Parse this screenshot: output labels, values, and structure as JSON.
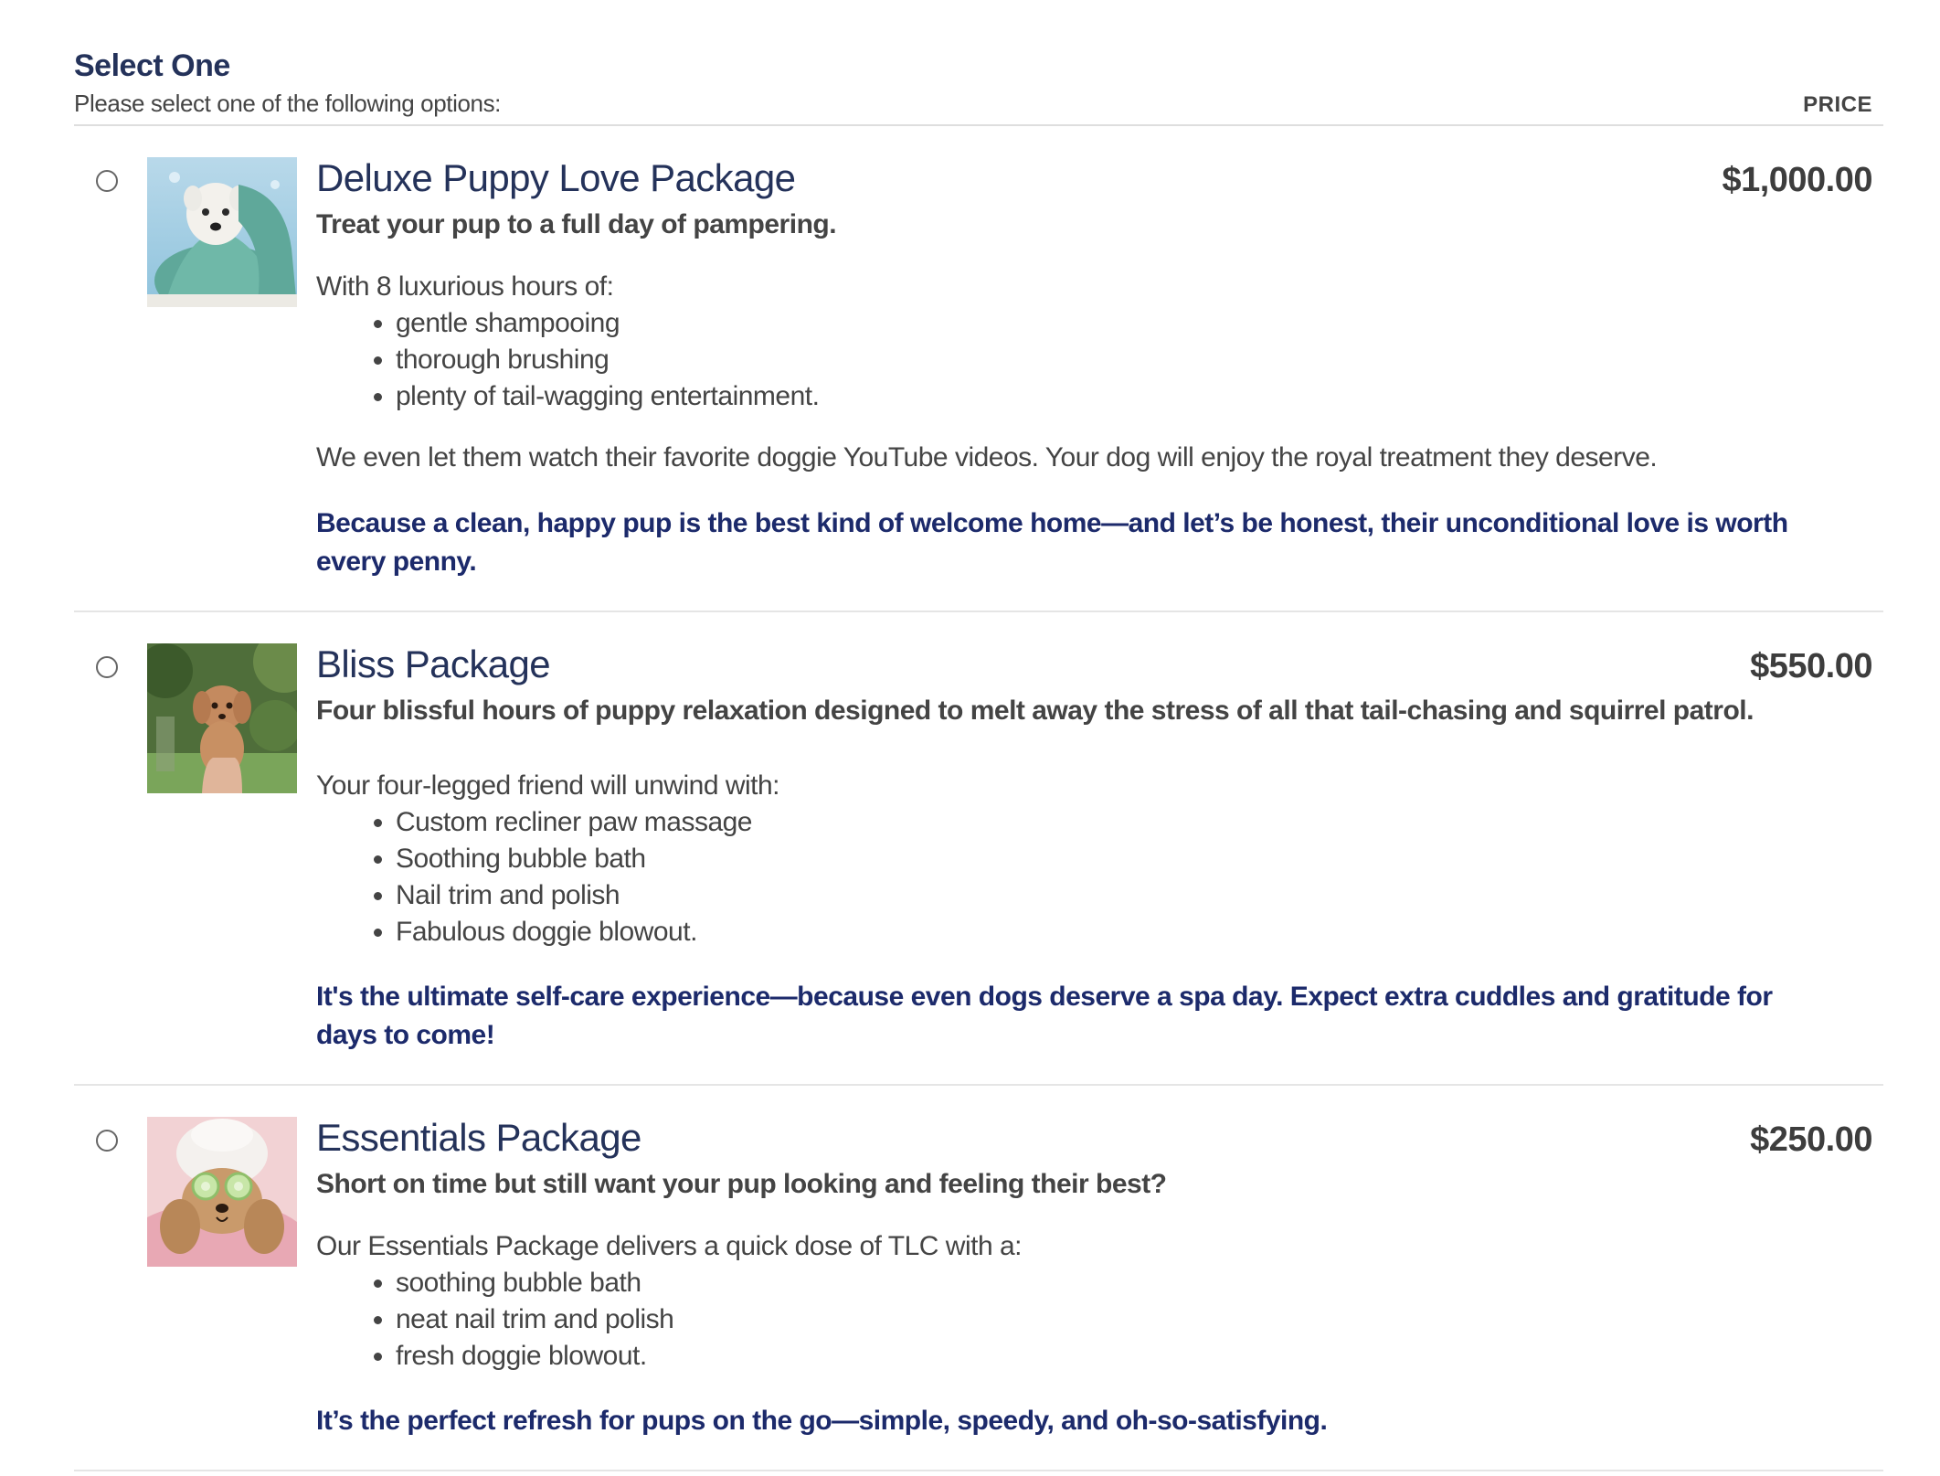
{
  "section": {
    "title": "Select One",
    "instructions": "Please select one of the following options:",
    "price_header": "PRICE"
  },
  "options": [
    {
      "title": "Deluxe Puppy Love Package",
      "price": "$1,000.00",
      "tagline": "Treat your pup to a full day of pampering.",
      "intro": "With 8 luxurious hours of:",
      "features": [
        "gentle shampooing",
        "thorough brushing",
        "plenty of tail-wagging entertainment."
      ],
      "body": "We even let them watch their favorite doggie YouTube videos. Your dog will enjoy the royal treatment they deserve.",
      "closing": "Because a clean, happy pup is the best kind of welcome home—and let’s be honest, their unconditional love is worth every penny.",
      "image": "white-terrier-in-towel"
    },
    {
      "title": "Bliss Package",
      "price": "$550.00",
      "tagline": "Four blissful hours of puppy relaxation designed to melt away the stress of all that tail-chasing and squirrel patrol.",
      "intro": "Your four-legged friend will unwind with:",
      "features": [
        "Custom recliner paw massage",
        "Soothing bubble bath",
        "Nail trim and polish",
        "Fabulous doggie blowout."
      ],
      "closing": "It's the ultimate self-care experience—because even dogs deserve a spa day. Expect extra cuddles and gratitude for days to come!",
      "image": "poodle-puppy-held-outdoors"
    },
    {
      "title": "Essentials Package",
      "price": "$250.00",
      "tagline": "Short on time but still want your pup looking and feeling their best?",
      "intro": "Our Essentials Package delivers a quick dose of TLC with a:",
      "features": [
        "soothing bubble bath",
        "neat nail trim and polish",
        "fresh doggie blowout."
      ],
      "closing": "It’s the perfect refresh for pups on the go—simple, speedy, and oh-so-satisfying.",
      "image": "dog-with-cucumber-eyes-and-towel"
    }
  ]
}
